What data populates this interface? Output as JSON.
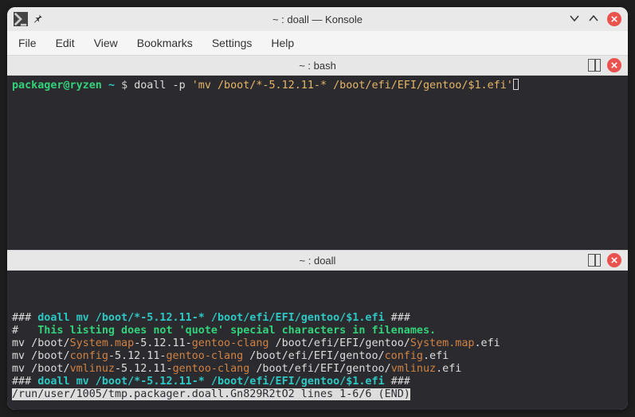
{
  "titlebar": {
    "title": "~ : doall — Konsole"
  },
  "menu": {
    "file": "File",
    "edit": "Edit",
    "view": "View",
    "bookmarks": "Bookmarks",
    "settings": "Settings",
    "help": "Help"
  },
  "pane1": {
    "title": "~ : bash",
    "user": "packager@ryzen",
    "path": "~",
    "prompt": "$",
    "cmd_1": "doall -p ",
    "cmd_arg": "'mv /boot/*-5.12.11-* /boot/efi/EFI/gentoo/$1.efi'"
  },
  "pane2": {
    "title": "~ : doall",
    "hdr_prefix": "### ",
    "hdr_cmd": "doall mv /boot/*-5.12.11-* /boot/efi/EFI/gentoo/$1.efi",
    "hdr_suffix": " ###",
    "hint_prefix": "#   ",
    "hint": "This listing does not 'quote' special characters in filenames.",
    "lines": [
      {
        "a": "mv /boot/",
        "b": "System.map",
        "c": "-5.12.11-",
        "d": "gentoo-clang",
        "e": " /boot/efi/EFI/gentoo/",
        "f": "System.map",
        "g": ".efi"
      },
      {
        "a": "mv /boot/",
        "b": "config",
        "c": "-5.12.11-",
        "d": "gentoo-clang",
        "e": " /boot/efi/EFI/gentoo/",
        "f": "config",
        "g": ".efi"
      },
      {
        "a": "mv /boot/",
        "b": "vmlinuz",
        "c": "-5.12.11-",
        "d": "gentoo-clang",
        "e": " /boot/efi/EFI/gentoo/",
        "f": "vmlinuz",
        "g": ".efi"
      }
    ],
    "status": "/run/user/1005/tmp.packager.doall.Gn829R2tO2 lines 1-6/6 (END)"
  }
}
